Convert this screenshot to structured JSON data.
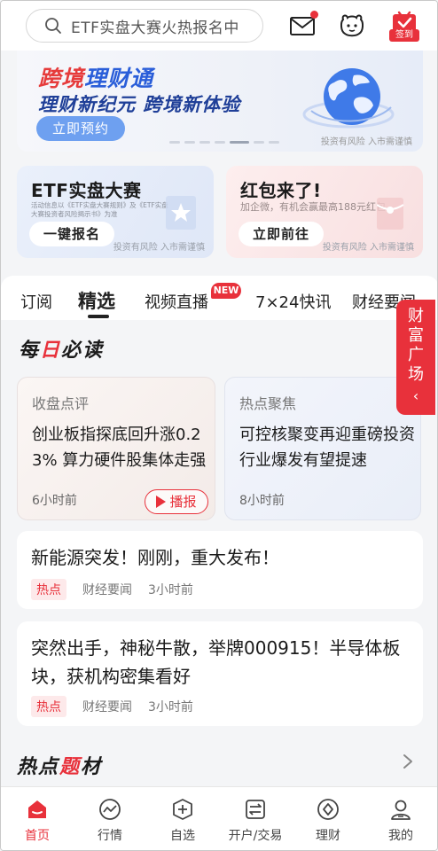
{
  "search": {
    "placeholder": "ETF实盘大赛火热报名中"
  },
  "header": {
    "signin_label": "签到"
  },
  "banner": {
    "title_red": "跨境",
    "title_blue": "理财通",
    "subtitle": "理财新纪元 跨境新体验",
    "button": "立即预约",
    "risk": "投资有风险 入市需谨慎"
  },
  "promos": [
    {
      "title": "ETF实盘大赛",
      "desc": "活动信息以《ETF实盘大赛规则》及《ETF实盘大赛投资者风险揭示书》为准",
      "button": "一键报名",
      "risk": "投资有风险 入市需谨慎"
    },
    {
      "title": "红包来了!",
      "desc": "加企微，有机会赢最高188元红包",
      "button": "立即前往",
      "risk": "投资有风险 入市需谨慎"
    }
  ],
  "tabs": [
    "订阅",
    "精选",
    "视频直播",
    "7×24快讯",
    "财经要闻"
  ],
  "new_badge": "NEW",
  "side_tab": [
    "财",
    "富",
    "广",
    "场"
  ],
  "section_daily": {
    "pre": "每",
    "mark": "日",
    "post": "必读"
  },
  "daily_cards": [
    {
      "tag": "收盘点评",
      "text": "创业板指探底回升涨0.23% 算力硬件股集体走强",
      "time": "6小时前",
      "play": "播报"
    },
    {
      "tag": "热点聚焦",
      "text": "可控核聚变再迎重磅投资 行业爆发有望提速",
      "time": "8小时前"
    }
  ],
  "news": [
    {
      "title": "新能源突发！刚刚，重大发布！",
      "tag": "热点",
      "source": "财经要闻",
      "time": "3小时前"
    },
    {
      "title": "突然出手，神秘牛散，举牌000915！半导体板块，获机构密集看好",
      "tag": "热点",
      "source": "财经要闻",
      "time": "3小时前"
    }
  ],
  "section_topics": {
    "pre": "热点",
    "mark": "题",
    "post": "材"
  },
  "bottom_nav": [
    {
      "label": "首页",
      "icon": "home-icon"
    },
    {
      "label": "行情",
      "icon": "market-icon"
    },
    {
      "label": "自选",
      "icon": "watchlist-icon"
    },
    {
      "label": "开户/交易",
      "icon": "trade-icon"
    },
    {
      "label": "理财",
      "icon": "wealth-icon"
    },
    {
      "label": "我的",
      "icon": "profile-icon"
    }
  ],
  "colors": {
    "accent": "#e8313b",
    "brand_blue": "#2a5ed9"
  }
}
